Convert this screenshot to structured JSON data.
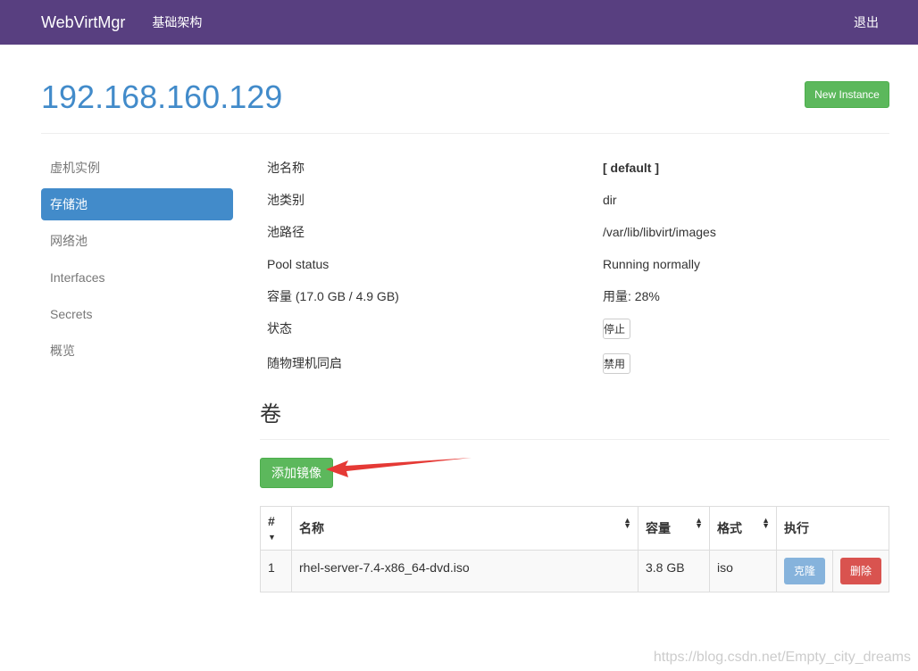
{
  "nav": {
    "brand": "WebVirtMgr",
    "infrastructure": "基础架构",
    "logout": "退出"
  },
  "page": {
    "title": "192.168.160.129",
    "new_instance": "New Instance"
  },
  "sidebar": {
    "items": [
      {
        "label": "虚机实例"
      },
      {
        "label": "存储池",
        "active": true
      },
      {
        "label": "网络池"
      },
      {
        "label": "Interfaces"
      },
      {
        "label": "Secrets"
      },
      {
        "label": "概览"
      }
    ]
  },
  "pool": {
    "rows": [
      {
        "key": "池名称",
        "value": "[ default ]"
      },
      {
        "key": "池类别",
        "value": "dir"
      },
      {
        "key": "池路径",
        "value": "/var/lib/libvirt/images"
      },
      {
        "key": "Pool status",
        "value": "Running normally"
      },
      {
        "key": "容量 (17.0 GB / 4.9 GB)",
        "value": "用量: 28%"
      },
      {
        "key": "状态",
        "value": "停止"
      },
      {
        "key": "随物理机同启",
        "value": "禁用"
      }
    ]
  },
  "volumes": {
    "heading": "卷",
    "add_label": "添加镜像",
    "columns": [
      "#",
      "名称",
      "容量",
      "格式",
      "执行"
    ],
    "rows": [
      {
        "index": "1",
        "name": "rhel-server-7.4-x86_64-dvd.iso",
        "size": "3.8 GB",
        "format": "iso",
        "clone": "克隆",
        "delete": "删除"
      }
    ]
  },
  "watermark": "https://blog.csdn.net/Empty_city_dreams",
  "colors": {
    "navbar": "#583f80",
    "primary": "#428bca",
    "success": "#5cb85c",
    "danger": "#d9534f",
    "annotation_arrow": "#e53935"
  }
}
